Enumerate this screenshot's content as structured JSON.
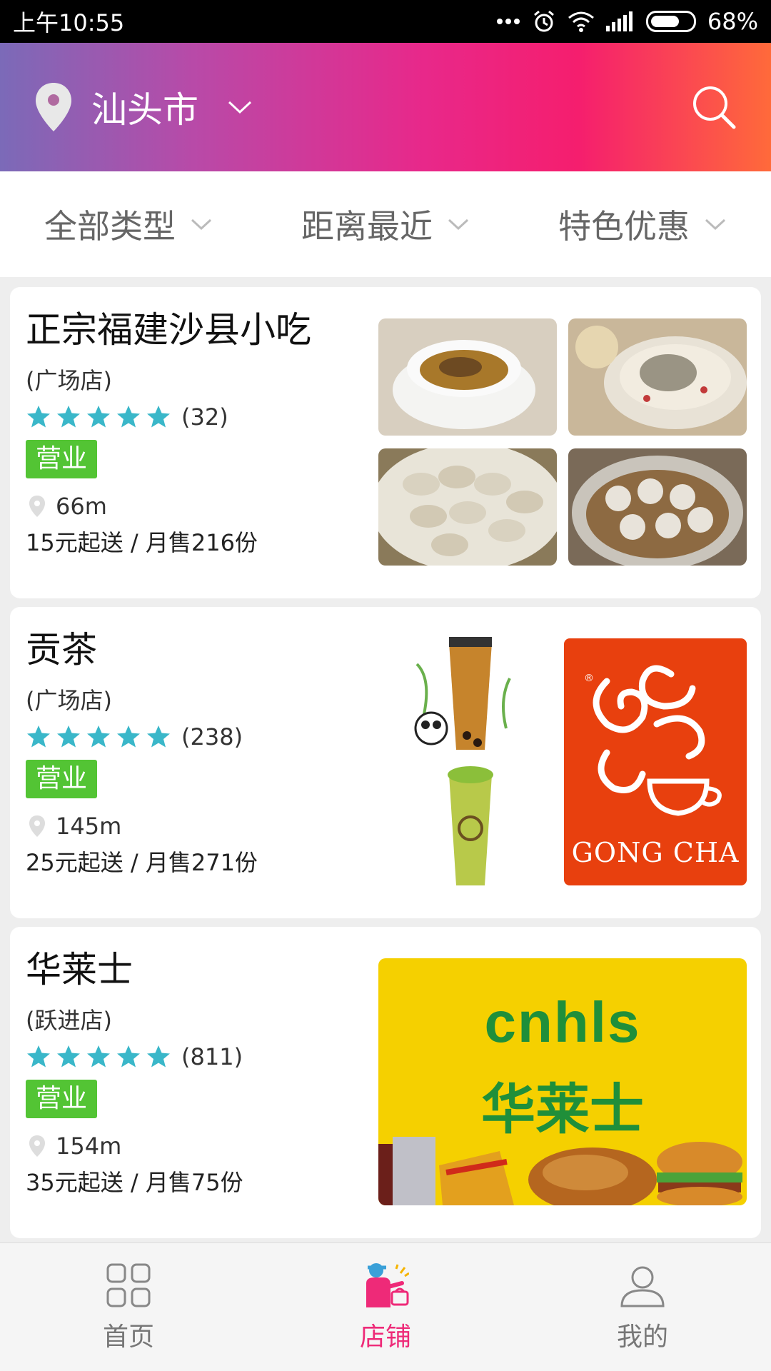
{
  "status_bar": {
    "time": "上午10:55",
    "battery": "68%",
    "battery_level": 0.68
  },
  "header": {
    "city": "汕头市",
    "icons": [
      "location-pin-icon",
      "chevron-down-icon",
      "search-icon"
    ]
  },
  "filters": [
    {
      "label": "全部类型"
    },
    {
      "label": "距离最近"
    },
    {
      "label": "特色优惠"
    }
  ],
  "stores": [
    {
      "name": "正宗福建沙县小吃",
      "branch": "(广场店)",
      "rating_stars": 5,
      "review_count": "(32)",
      "status": "营业",
      "distance": "66m",
      "delivery_info": "15元起送 / 月售216份"
    },
    {
      "name": "贡茶",
      "branch": "(广场店)",
      "rating_stars": 5,
      "review_count": "(238)",
      "status": "营业",
      "distance": "145m",
      "delivery_info": "25元起送 / 月售271份",
      "logo_text": "GONG CHA"
    },
    {
      "name": "华莱士",
      "branch": "(跃进店)",
      "rating_stars": 5,
      "review_count": "(811)",
      "status": "营业",
      "distance": "154m",
      "delivery_info": "35元起送 / 月售75份",
      "logo_text_top": "cnhls",
      "logo_text_cn": "华莱士"
    }
  ],
  "bottom_nav": [
    {
      "label": "首页",
      "icon": "home-grid-icon"
    },
    {
      "label": "店铺",
      "icon": "shop-icon",
      "active": true
    },
    {
      "label": "我的",
      "icon": "user-icon"
    }
  ],
  "colors": {
    "accent": "#ee2a78",
    "star": "#3ab7c9",
    "badge": "#53c434"
  }
}
